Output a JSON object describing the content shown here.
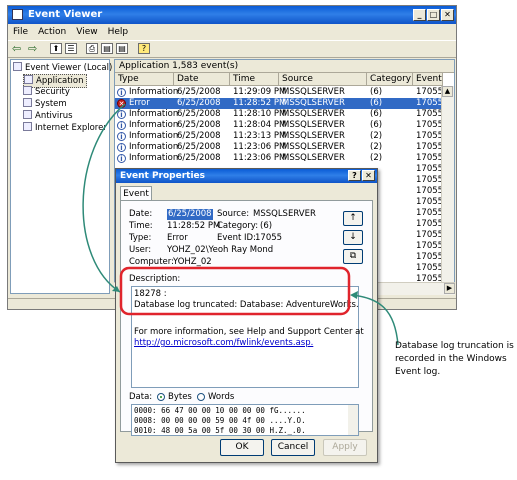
{
  "window": {
    "title": "Event Viewer",
    "min": "_",
    "max": "□",
    "close": "✕"
  },
  "menu": [
    "File",
    "Action",
    "View",
    "Help"
  ],
  "toolbar": {
    "back": "⇦",
    "forward": "⇨",
    "up": "⬆",
    "props": "☰",
    "export": "⎙",
    "print": "▤",
    "help": "?"
  },
  "tree": {
    "root": "Event Viewer (Local)",
    "items": [
      "Application",
      "Security",
      "System",
      "Antivirus",
      "Internet Explorer"
    ]
  },
  "list": {
    "header": "Application   1,583 event(s)",
    "columns": [
      "Type",
      "Date",
      "Time",
      "Source",
      "Category",
      "Event"
    ],
    "rows": [
      [
        "Information",
        "6/25/2008",
        "11:29:09 PM",
        "MSSQLSERVER",
        "(6)",
        "17055"
      ],
      [
        "Error",
        "6/25/2008",
        "11:28:52 PM",
        "MSSQLSERVER",
        "(6)",
        "17055"
      ],
      [
        "Information",
        "6/25/2008",
        "11:28:10 PM",
        "MSSQLSERVER",
        "(6)",
        "17055"
      ],
      [
        "Information",
        "6/25/2008",
        "11:28:04 PM",
        "MSSQLSERVER",
        "(6)",
        "17055"
      ],
      [
        "Information",
        "6/25/2008",
        "11:23:13 PM",
        "MSSQLSERVER",
        "(2)",
        "17055"
      ],
      [
        "Information",
        "6/25/2008",
        "11:23:06 PM",
        "MSSQLSERVER",
        "(2)",
        "17055"
      ],
      [
        "Information",
        "6/25/2008",
        "11:23:06 PM",
        "MSSQLSERVER",
        "(2)",
        "17055"
      ]
    ],
    "extra_events": [
      "17055",
      "17055",
      "17055",
      "17055",
      "17055",
      "17055",
      "17055",
      "17055",
      "17055",
      "17055",
      "17055",
      "17055"
    ]
  },
  "dialog": {
    "title": "Event Properties",
    "help": "?",
    "close": "✕",
    "tab": "Event",
    "date_label": "Date:",
    "date": "6/25/2008",
    "source_label": "Source:",
    "source": "MSSQLSERVER",
    "time_label": "Time:",
    "time": "11:28:52 PM",
    "category_label": "Category:",
    "category": "(6)",
    "type_label": "Type:",
    "type": "Error",
    "eventid_label": "Event ID:",
    "eventid": "17055",
    "user_label": "User:",
    "user": "YOHZ_02\\Yeoh Ray Mond",
    "computer_label": "Computer:",
    "computer": "YOHZ_02",
    "description_label": "Description:",
    "desc_line1": "18278 :",
    "desc_line2": "Database log truncated: Database: AdventureWorks.",
    "more_info": "For more information, see Help and Support Center at",
    "link": "http://go.microsoft.com/fwlink/events.asp.",
    "data_label": "Data:",
    "bytes_label": "Bytes",
    "words_label": "Words",
    "hex": [
      "0000: 66 47 00 00 10 00 00 00   fG......",
      "0008: 00 00 00 00 59 00 4f 00   ....Y.O.",
      "0010: 48 00 5a 00 5f 00 30 00   H.Z._.0."
    ],
    "ok": "OK",
    "cancel": "Cancel",
    "apply": "Apply"
  },
  "callout": "Database log truncation is recorded in the Windows Event log.",
  "colors": {
    "highlight": "#e0242c",
    "arrow": "#2e8a78",
    "title_blue": "#0a5bd6",
    "select": "#316ac5"
  }
}
